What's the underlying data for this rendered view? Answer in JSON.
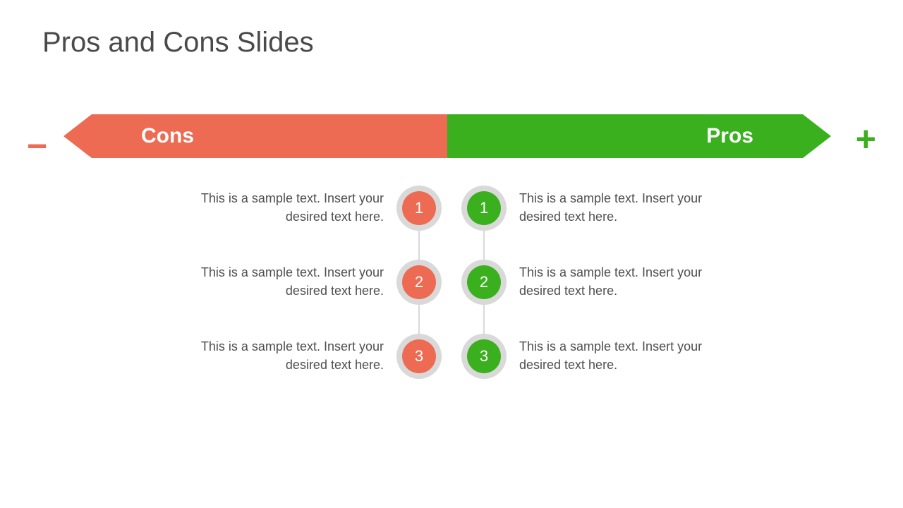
{
  "title": "Pros and Cons Slides",
  "cons": {
    "label": "Cons",
    "symbol": "−",
    "color": "#ed6a53",
    "items": [
      {
        "num": "1",
        "text": "This is a sample text. Insert your desired text here."
      },
      {
        "num": "2",
        "text": "This is a sample text. Insert your desired text here."
      },
      {
        "num": "3",
        "text": "This is a sample text. Insert your desired text here."
      }
    ]
  },
  "pros": {
    "label": "Pros",
    "symbol": "+",
    "color": "#3bb01e",
    "items": [
      {
        "num": "1",
        "text": "This is a sample text. Insert your desired text here."
      },
      {
        "num": "2",
        "text": "This is a sample text. Insert your desired text here."
      },
      {
        "num": "3",
        "text": "This is a sample text. Insert your desired text here."
      }
    ]
  }
}
